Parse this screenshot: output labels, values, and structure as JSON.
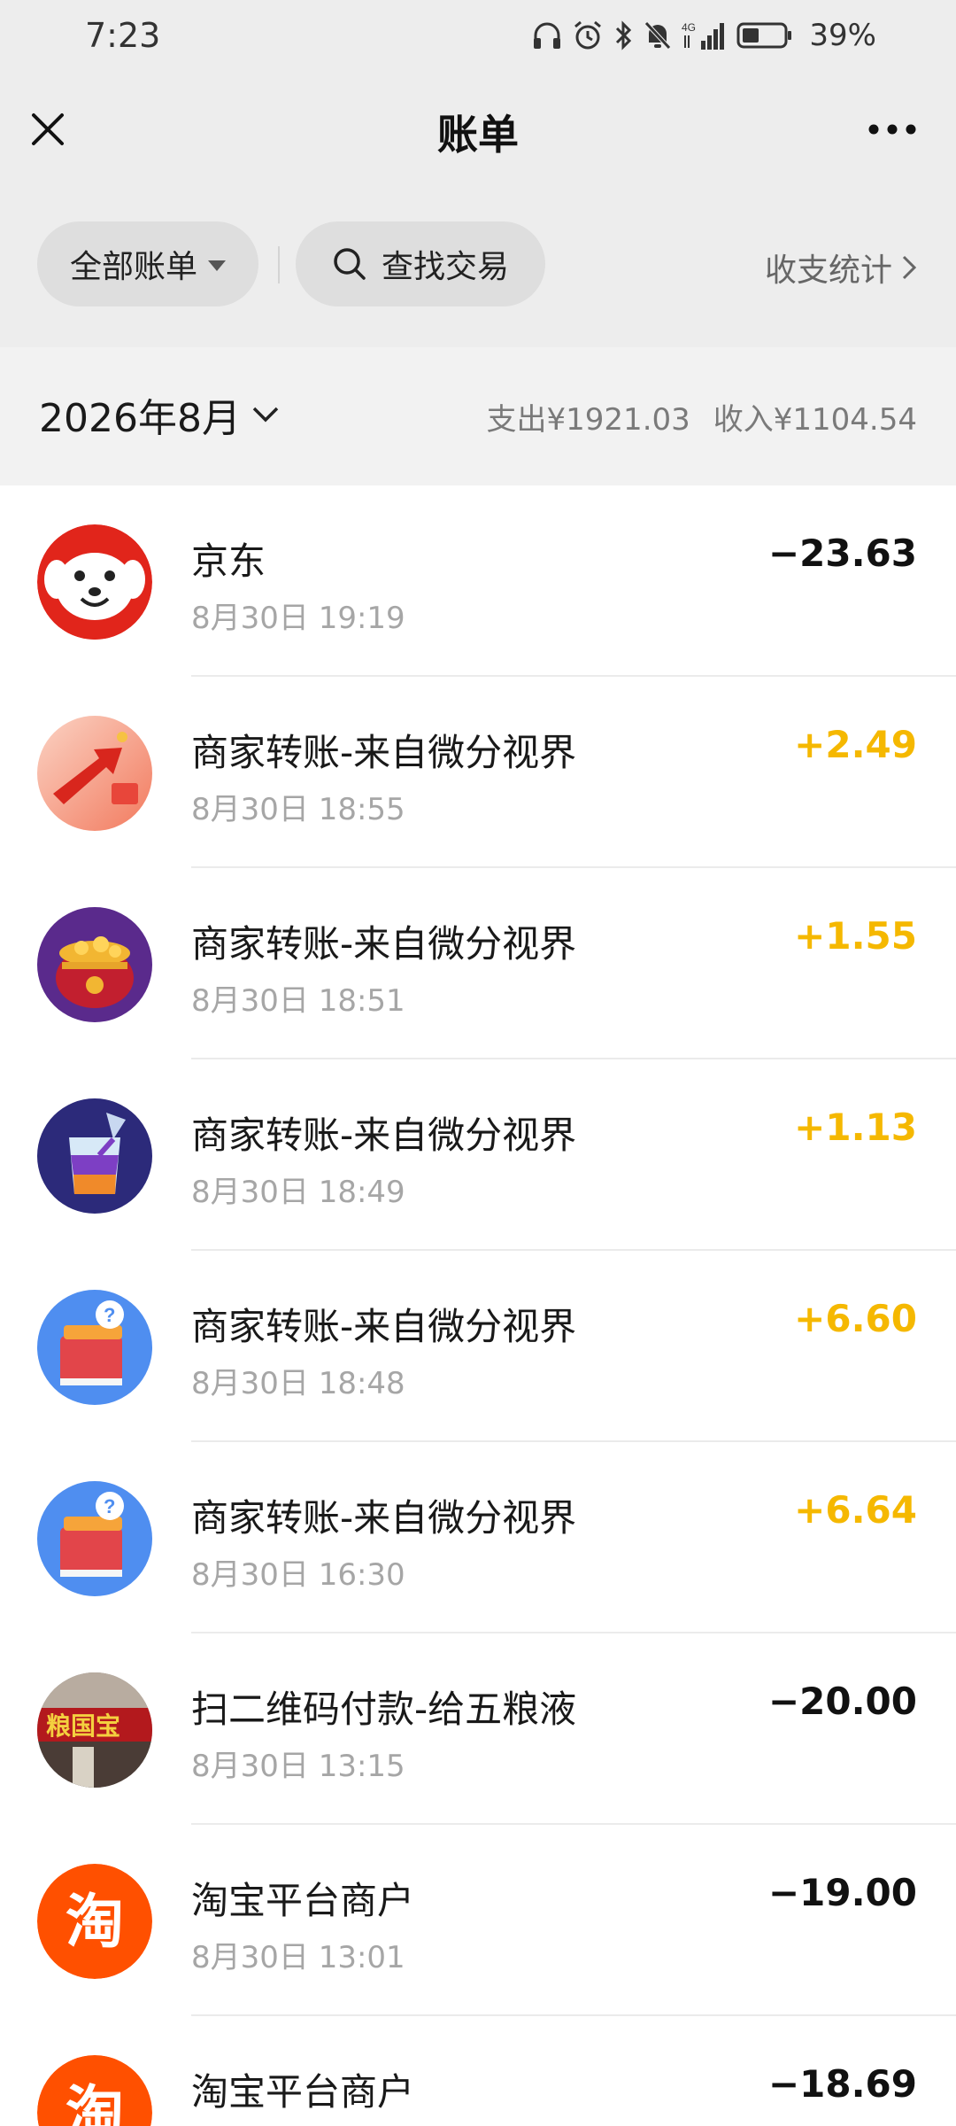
{
  "status": {
    "time": "7:23",
    "signal_label": "4G",
    "battery_pct": "39%"
  },
  "nav": {
    "title": "账单"
  },
  "filters": {
    "all_bills": "全部账单",
    "search": "查找交易",
    "stats": "收支统计"
  },
  "month": {
    "label": "2026年8月",
    "expense": "支出¥1921.03",
    "income": "收入¥1104.54"
  },
  "colors": {
    "income": "#f5b800",
    "expense": "#111111"
  },
  "transactions": [
    {
      "name": "京东",
      "time": "8月30日 19:19",
      "amount": "−23.63",
      "type": "expense",
      "icon": "jd-dog-logo"
    },
    {
      "name": "商家转账-来自微分视界",
      "time": "8月30日 18:55",
      "amount": "+2.49",
      "type": "income",
      "icon": "red-arrow-icon"
    },
    {
      "name": "商家转账-来自微分视界",
      "time": "8月30日 18:51",
      "amount": "+1.55",
      "type": "income",
      "icon": "treasure-pot-icon"
    },
    {
      "name": "商家转账-来自微分视界",
      "time": "8月30日 18:49",
      "amount": "+1.13",
      "type": "income",
      "icon": "drink-cup-icon"
    },
    {
      "name": "商家转账-来自微分视界",
      "time": "8月30日 18:48",
      "amount": "+6.60",
      "type": "income",
      "icon": "quiz-book-icon"
    },
    {
      "name": "商家转账-来自微分视界",
      "time": "8月30日 16:30",
      "amount": "+6.64",
      "type": "income",
      "icon": "quiz-book-icon"
    },
    {
      "name": "扫二维码付款-给五粮液",
      "time": "8月30日 13:15",
      "amount": "−20.00",
      "type": "expense",
      "icon": "shop-front-photo",
      "sign_text": "粮国宝"
    },
    {
      "name": "淘宝平台商户",
      "time": "8月30日 13:01",
      "amount": "−19.00",
      "type": "expense",
      "icon": "taobao-logo",
      "logo_char": "淘"
    },
    {
      "name": "淘宝平台商户",
      "time": "",
      "amount": "−18.69",
      "type": "expense",
      "icon": "taobao-logo",
      "logo_char": "淘"
    }
  ]
}
